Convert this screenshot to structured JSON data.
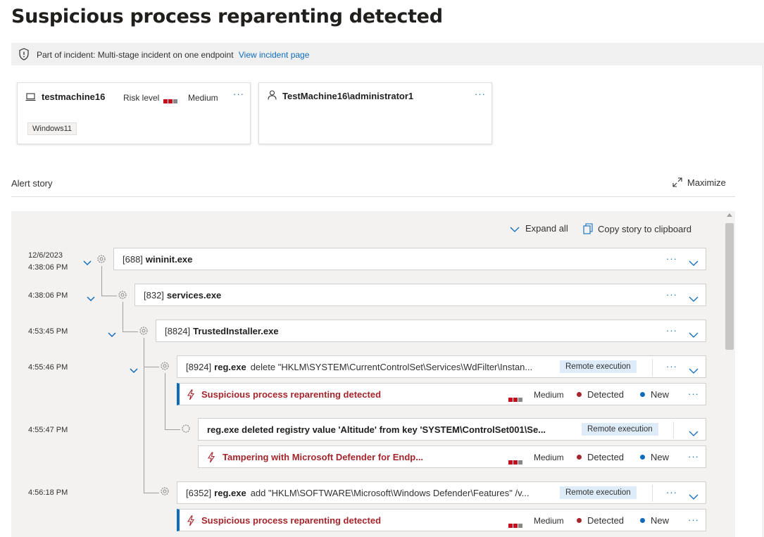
{
  "page_title": "Suspicious process reparenting detected",
  "incident_banner": {
    "prefix": "Part of incident:",
    "incident_name": "Multi-stage incident on one endpoint",
    "link": "View incident page"
  },
  "device_card": {
    "name": "testmachine16",
    "risk_label": "Risk level",
    "risk_value": "Medium",
    "os_tag": "Windows11",
    "more": "···"
  },
  "user_card": {
    "name": "TestMachine16\\administrator1",
    "more": "···"
  },
  "alert_story": {
    "title": "Alert story",
    "maximize": "Maximize"
  },
  "toolbar": {
    "expand_all": "Expand all",
    "copy_story": "Copy story to clipboard"
  },
  "colors": {
    "accent": "#0f6cbd",
    "alert_red": "#a4262c",
    "severity_red": "#c50f1f",
    "severity_gray": "#8a8886",
    "status_detected": "#a4262c",
    "status_new": "#0f6cbd"
  },
  "tree": [
    {
      "date": "12/6/2023",
      "time": "4:38:06 PM",
      "pid": "[688]",
      "name": "wininit.exe",
      "cmd": ""
    },
    {
      "time": "4:38:06 PM",
      "pid": "[832]",
      "name": "services.exe",
      "cmd": ""
    },
    {
      "time": "4:53:45 PM",
      "pid": "[8824]",
      "name": "TrustedInstaller.exe",
      "cmd": ""
    },
    {
      "time": "4:55:46 PM",
      "pid": "[8924]",
      "name": "reg.exe",
      "cmd": "delete \"HKLM\\SYSTEM\\CurrentControlSet\\Services\\WdFilter\\Instan...",
      "badge": "Remote execution"
    },
    {
      "time": "4:55:47 PM",
      "pid": "",
      "name": "reg.exe deleted registry value 'Altitude' from key 'SYSTEM\\ControlSet001\\Se...",
      "cmd": "",
      "badge": "Remote execution"
    },
    {
      "time": "4:56:18 PM",
      "pid": "[6352]",
      "name": "reg.exe",
      "cmd": "add \"HKLM\\SOFTWARE\\Microsoft\\Windows Defender\\Features\" /v...",
      "badge": "Remote execution"
    }
  ],
  "alerts": [
    {
      "title": "Suspicious process reparenting detected",
      "severity": "Medium",
      "status": "Detected",
      "state": "New"
    },
    {
      "title": "Tampering with Microsoft Defender for Endp...",
      "severity": "Medium",
      "status": "Detected",
      "state": "New"
    },
    {
      "title": "Suspicious process reparenting detected",
      "severity": "Medium",
      "status": "Detected",
      "state": "New"
    }
  ],
  "more": "···"
}
